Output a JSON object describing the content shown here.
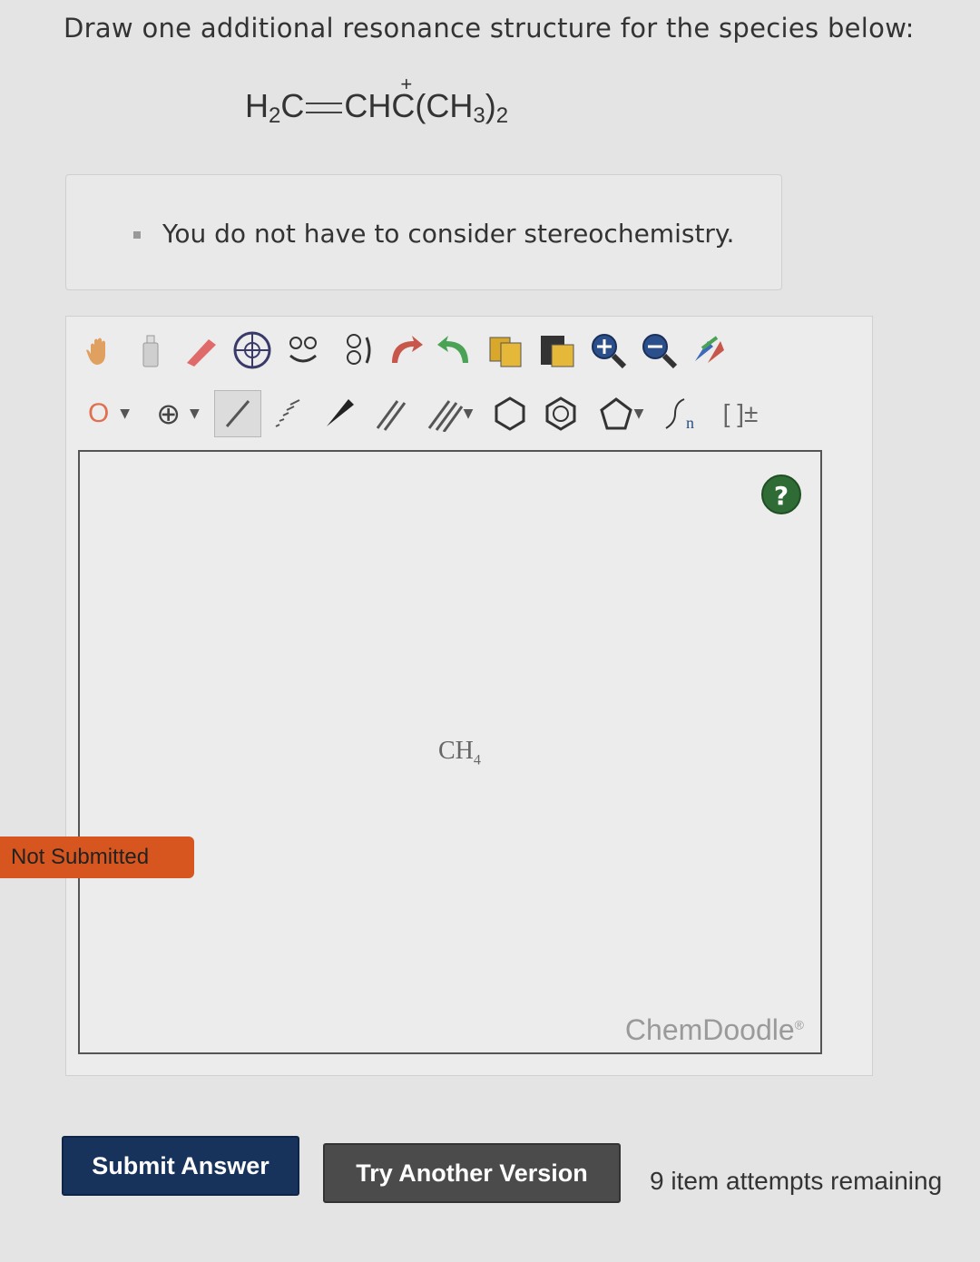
{
  "question": {
    "prompt": "Draw one additional resonance structure for the species below:",
    "formula": {
      "h2c": "H",
      "h2c_sub": "2",
      "c1": "C",
      "chc": "CH",
      "cplus_atom": "C",
      "cplus_charge": "+",
      "ch3_open": "(CH",
      "ch3_sub": "3",
      "ch3_close": ")",
      "count_sub": "2"
    }
  },
  "hint": {
    "text": "You do not have to consider stereochemistry."
  },
  "toolbar": {
    "row1_icons": [
      "hand-icon",
      "clear-icon",
      "eraser-icon",
      "center-icon",
      "flip-horizontal-icon",
      "flip-vertical-icon",
      "undo-icon",
      "redo-icon",
      "copy-icon",
      "paste-icon",
      "zoom-in-icon",
      "zoom-out-icon",
      "clean-icon"
    ],
    "atom_label": "O",
    "charge_label": "⊕",
    "template_labels": [
      "[ ]±"
    ]
  },
  "canvas": {
    "molecule_main": "CH",
    "molecule_sub": "4",
    "help_label": "?",
    "watermark": "ChemDoodle",
    "watermark_mark": "®"
  },
  "status": {
    "label": "Not Submitted",
    "color": "#d7561f"
  },
  "actions": {
    "submit_label": "Submit Answer",
    "try_label": "Try Another Version",
    "attempts_text": "9 item attempts remaining"
  }
}
